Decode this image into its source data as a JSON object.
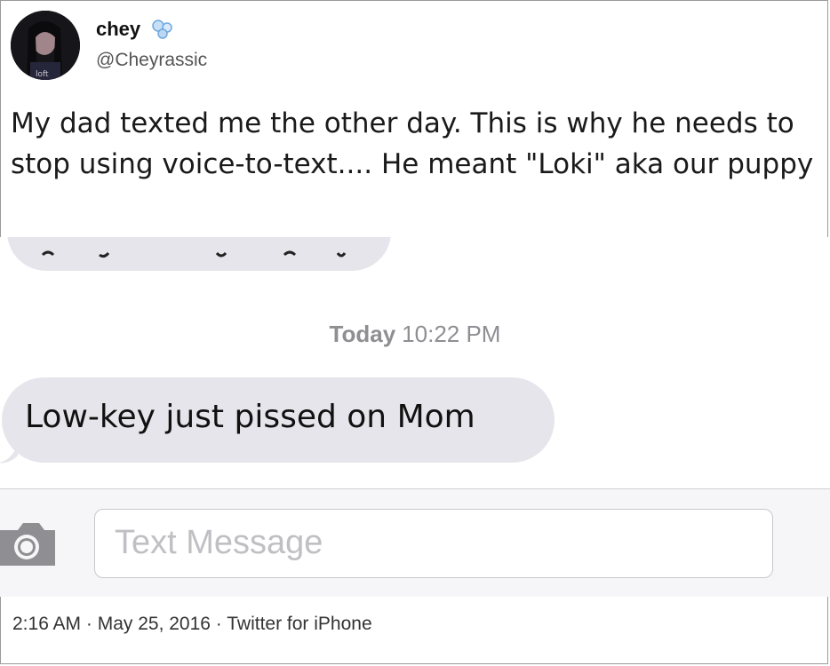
{
  "user": {
    "display_name": "chey",
    "handle": "@Cheyrassic"
  },
  "tweet": {
    "text": "My dad texted me the other day. This is why he needs to stop using voice-to-text.... He meant \"Loki\" aka our puppy",
    "meta": "2:16 AM · May 25, 2016 · Twitter for iPhone"
  },
  "messages_screenshot": {
    "timestamp_day": "Today",
    "timestamp_time": "10:22 PM",
    "message": "Low-key just pissed on Mom",
    "composer_placeholder": "Text Message"
  },
  "colors": {
    "bubble": "#e6e5eb",
    "timestamp": "#8e8e93",
    "placeholder": "#bfbfc4"
  },
  "icons": [
    "verified-badge-icon",
    "camera-icon"
  ]
}
